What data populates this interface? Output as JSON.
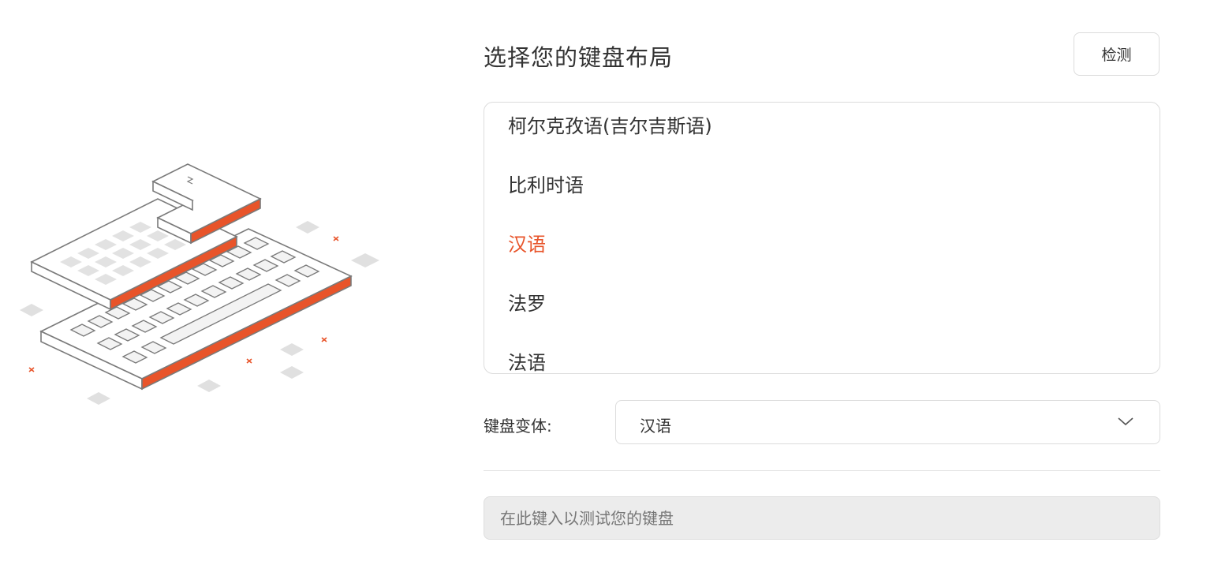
{
  "header": {
    "title": "选择您的键盘布局",
    "detect_label": "检测"
  },
  "layout_list": {
    "items": [
      {
        "label": "柯尔克孜语(吉尔吉斯语)",
        "selected": false
      },
      {
        "label": "比利时语",
        "selected": false
      },
      {
        "label": "汉语",
        "selected": true
      },
      {
        "label": "法罗",
        "selected": false
      },
      {
        "label": "法语",
        "selected": false
      }
    ]
  },
  "variant": {
    "label": "键盘变体:",
    "value": "汉语",
    "icon": "chevron-down-icon"
  },
  "test_input": {
    "value": "",
    "placeholder": "在此键入以测试您的键盘"
  },
  "colors": {
    "accent": "#e8542a",
    "border": "#dcdcdc",
    "input_bg": "#ececec"
  }
}
